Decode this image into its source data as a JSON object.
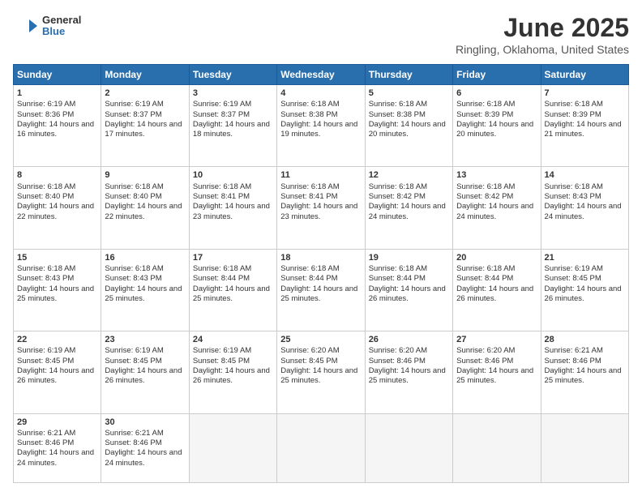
{
  "logo": {
    "general": "General",
    "blue": "Blue"
  },
  "title": "June 2025",
  "location": "Ringling, Oklahoma, United States",
  "headers": [
    "Sunday",
    "Monday",
    "Tuesday",
    "Wednesday",
    "Thursday",
    "Friday",
    "Saturday"
  ],
  "weeks": [
    [
      {
        "day": "1",
        "sunrise": "Sunrise: 6:19 AM",
        "sunset": "Sunset: 8:36 PM",
        "daylight": "Daylight: 14 hours and 16 minutes."
      },
      {
        "day": "2",
        "sunrise": "Sunrise: 6:19 AM",
        "sunset": "Sunset: 8:37 PM",
        "daylight": "Daylight: 14 hours and 17 minutes."
      },
      {
        "day": "3",
        "sunrise": "Sunrise: 6:19 AM",
        "sunset": "Sunset: 8:37 PM",
        "daylight": "Daylight: 14 hours and 18 minutes."
      },
      {
        "day": "4",
        "sunrise": "Sunrise: 6:18 AM",
        "sunset": "Sunset: 8:38 PM",
        "daylight": "Daylight: 14 hours and 19 minutes."
      },
      {
        "day": "5",
        "sunrise": "Sunrise: 6:18 AM",
        "sunset": "Sunset: 8:38 PM",
        "daylight": "Daylight: 14 hours and 20 minutes."
      },
      {
        "day": "6",
        "sunrise": "Sunrise: 6:18 AM",
        "sunset": "Sunset: 8:39 PM",
        "daylight": "Daylight: 14 hours and 20 minutes."
      },
      {
        "day": "7",
        "sunrise": "Sunrise: 6:18 AM",
        "sunset": "Sunset: 8:39 PM",
        "daylight": "Daylight: 14 hours and 21 minutes."
      }
    ],
    [
      {
        "day": "8",
        "sunrise": "Sunrise: 6:18 AM",
        "sunset": "Sunset: 8:40 PM",
        "daylight": "Daylight: 14 hours and 22 minutes."
      },
      {
        "day": "9",
        "sunrise": "Sunrise: 6:18 AM",
        "sunset": "Sunset: 8:40 PM",
        "daylight": "Daylight: 14 hours and 22 minutes."
      },
      {
        "day": "10",
        "sunrise": "Sunrise: 6:18 AM",
        "sunset": "Sunset: 8:41 PM",
        "daylight": "Daylight: 14 hours and 23 minutes."
      },
      {
        "day": "11",
        "sunrise": "Sunrise: 6:18 AM",
        "sunset": "Sunset: 8:41 PM",
        "daylight": "Daylight: 14 hours and 23 minutes."
      },
      {
        "day": "12",
        "sunrise": "Sunrise: 6:18 AM",
        "sunset": "Sunset: 8:42 PM",
        "daylight": "Daylight: 14 hours and 24 minutes."
      },
      {
        "day": "13",
        "sunrise": "Sunrise: 6:18 AM",
        "sunset": "Sunset: 8:42 PM",
        "daylight": "Daylight: 14 hours and 24 minutes."
      },
      {
        "day": "14",
        "sunrise": "Sunrise: 6:18 AM",
        "sunset": "Sunset: 8:43 PM",
        "daylight": "Daylight: 14 hours and 24 minutes."
      }
    ],
    [
      {
        "day": "15",
        "sunrise": "Sunrise: 6:18 AM",
        "sunset": "Sunset: 8:43 PM",
        "daylight": "Daylight: 14 hours and 25 minutes."
      },
      {
        "day": "16",
        "sunrise": "Sunrise: 6:18 AM",
        "sunset": "Sunset: 8:43 PM",
        "daylight": "Daylight: 14 hours and 25 minutes."
      },
      {
        "day": "17",
        "sunrise": "Sunrise: 6:18 AM",
        "sunset": "Sunset: 8:44 PM",
        "daylight": "Daylight: 14 hours and 25 minutes."
      },
      {
        "day": "18",
        "sunrise": "Sunrise: 6:18 AM",
        "sunset": "Sunset: 8:44 PM",
        "daylight": "Daylight: 14 hours and 25 minutes."
      },
      {
        "day": "19",
        "sunrise": "Sunrise: 6:18 AM",
        "sunset": "Sunset: 8:44 PM",
        "daylight": "Daylight: 14 hours and 26 minutes."
      },
      {
        "day": "20",
        "sunrise": "Sunrise: 6:18 AM",
        "sunset": "Sunset: 8:44 PM",
        "daylight": "Daylight: 14 hours and 26 minutes."
      },
      {
        "day": "21",
        "sunrise": "Sunrise: 6:19 AM",
        "sunset": "Sunset: 8:45 PM",
        "daylight": "Daylight: 14 hours and 26 minutes."
      }
    ],
    [
      {
        "day": "22",
        "sunrise": "Sunrise: 6:19 AM",
        "sunset": "Sunset: 8:45 PM",
        "daylight": "Daylight: 14 hours and 26 minutes."
      },
      {
        "day": "23",
        "sunrise": "Sunrise: 6:19 AM",
        "sunset": "Sunset: 8:45 PM",
        "daylight": "Daylight: 14 hours and 26 minutes."
      },
      {
        "day": "24",
        "sunrise": "Sunrise: 6:19 AM",
        "sunset": "Sunset: 8:45 PM",
        "daylight": "Daylight: 14 hours and 26 minutes."
      },
      {
        "day": "25",
        "sunrise": "Sunrise: 6:20 AM",
        "sunset": "Sunset: 8:45 PM",
        "daylight": "Daylight: 14 hours and 25 minutes."
      },
      {
        "day": "26",
        "sunrise": "Sunrise: 6:20 AM",
        "sunset": "Sunset: 8:46 PM",
        "daylight": "Daylight: 14 hours and 25 minutes."
      },
      {
        "day": "27",
        "sunrise": "Sunrise: 6:20 AM",
        "sunset": "Sunset: 8:46 PM",
        "daylight": "Daylight: 14 hours and 25 minutes."
      },
      {
        "day": "28",
        "sunrise": "Sunrise: 6:21 AM",
        "sunset": "Sunset: 8:46 PM",
        "daylight": "Daylight: 14 hours and 25 minutes."
      }
    ],
    [
      {
        "day": "29",
        "sunrise": "Sunrise: 6:21 AM",
        "sunset": "Sunset: 8:46 PM",
        "daylight": "Daylight: 14 hours and 24 minutes."
      },
      {
        "day": "30",
        "sunrise": "Sunrise: 6:21 AM",
        "sunset": "Sunset: 8:46 PM",
        "daylight": "Daylight: 14 hours and 24 minutes."
      },
      null,
      null,
      null,
      null,
      null
    ]
  ]
}
